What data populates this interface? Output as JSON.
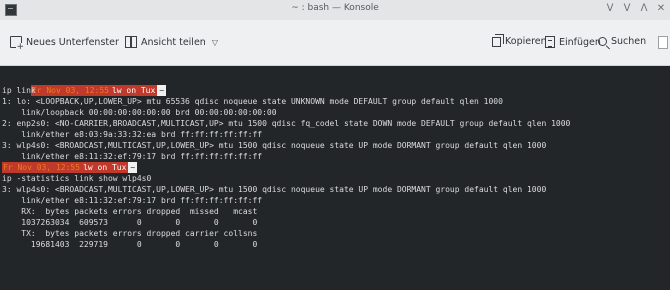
{
  "window": {
    "title": "~ : bash — Konsole",
    "controls": [
      "ᐯ",
      "ᐯ",
      "ᐱ",
      "✕"
    ]
  },
  "toolbar": {
    "new_tab_label": "Neues Unterfenster",
    "split_view_label": "Ansicht teilen",
    "copy_label": "Kopieren",
    "paste_label": "Einfügen",
    "search_label": "Suchen"
  },
  "terminal": {
    "prompt1": {
      "date": "Fr Nov 03, 12:55",
      "user": "lw on Tux",
      "dir": "~"
    },
    "cmd1": "ip link",
    "out1": [
      "1: lo: <LOOPBACK,UP,LOWER_UP> mtu 65536 qdisc noqueue state UNKNOWN mode DEFAULT group default qlen 1000",
      "    link/loopback 00:00:00:00:00:00 brd 00:00:00:00:00:00",
      "2: enp2s0: <NO-CARRIER,BROADCAST,MULTICAST,UP> mtu 1500 qdisc fq_codel state DOWN mode DEFAULT group default qlen 1000",
      "    link/ether e8:03:9a:33:32:ea brd ff:ff:ff:ff:ff:ff",
      "3: wlp4s0: <BROADCAST,MULTICAST,UP,LOWER_UP> mtu 1500 qdisc noqueue state UP mode DORMANT group default qlen 1000",
      "    link/ether e8:11:32:ef:79:17 brd ff:ff:ff:ff:ff:ff"
    ],
    "prompt2": {
      "date": "Fr Nov 03, 12:55",
      "user": "lw on Tux",
      "dir": "~"
    },
    "cmd2": "ip -statistics link show wlp4s0",
    "out2": [
      "3: wlp4s0: <BROADCAST,MULTICAST,UP,LOWER_UP> mtu 1500 qdisc noqueue state UP mode DORMANT group default qlen 1000",
      "    link/ether e8:11:32:ef:79:17 brd ff:ff:ff:ff:ff:ff",
      "    RX:  bytes packets errors dropped  missed   mcast",
      "    1037263034  609573      0       0       0       0",
      "    TX:  bytes packets errors dropped carrier collsns",
      "      19681403  229719      0       0       0       0"
    ]
  },
  "colors": {
    "terminal_bg": "#232629",
    "terminal_fg": "#dcdcdc",
    "prompt_red": "#c0392b",
    "prompt_orange": "#e67e22"
  }
}
